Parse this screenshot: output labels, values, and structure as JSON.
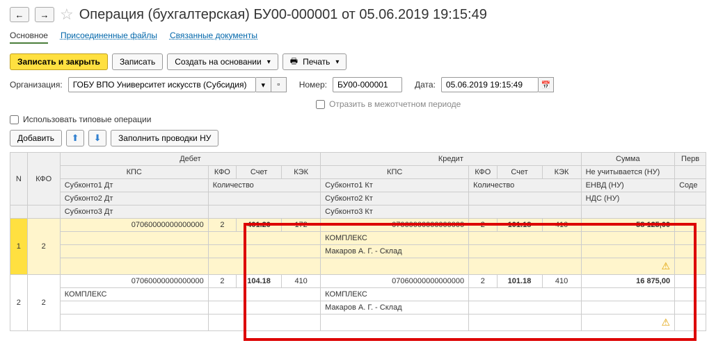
{
  "nav": {
    "back": "←",
    "forward": "→"
  },
  "title": "Операция (бухгалтерская) БУ00-000001 от 05.06.2019 19:15:49",
  "tabs": {
    "main": "Основное",
    "files": "Присоединенные файлы",
    "docs": "Связанные документы"
  },
  "toolbar1": {
    "save_close": "Записать и закрыть",
    "save": "Записать",
    "create_based": "Создать на основании",
    "print": "Печать"
  },
  "form": {
    "org_label": "Организация:",
    "org_value": "ГОБУ ВПО Университет искусств (Субсидия)",
    "number_label": "Номер:",
    "number_value": "БУ00-000001",
    "date_label": "Дата:",
    "date_value": "05.06.2019 19:15:49",
    "interperiod": "Отразить в межотчетном периоде",
    "use_typical": "Использовать типовые операции"
  },
  "toolbar2": {
    "add": "Добавить",
    "fill_nu": "Заполнить проводки НУ"
  },
  "grid": {
    "headers": {
      "n": "N",
      "kfo": "КФО",
      "debit": "Дебет",
      "credit": "Кредит",
      "sum": "Сумма",
      "perv": "Перв",
      "kps": "КПС",
      "kfo2": "КФО",
      "acct": "Счет",
      "kek": "КЭК",
      "not_nu": "Не учитывается (НУ)",
      "sub1d": "Субконто1 Дт",
      "sub2d": "Субконто2 Дт",
      "sub3d": "Субконто3 Дт",
      "qty": "Количество",
      "sub1k": "Субконто1 Кт",
      "sub2k": "Субконто2 Кт",
      "sub3k": "Субконто3 Кт",
      "envd": "ЕНВД (НУ)",
      "nds": "НДС (НУ)",
      "sod": "Соде"
    },
    "rows": [
      {
        "n": "1",
        "kfo": "2",
        "d_kps": "07060000000000000",
        "d_kfo": "2",
        "d_acct": "401.20",
        "d_kek": "172",
        "c_kps": "07060000000000000",
        "c_kfo": "2",
        "c_acct": "101.18",
        "c_kek": "410",
        "sum": "58 125,00",
        "c_sub1": "КОМПЛЕКС",
        "c_sub2": "Макаров А. Г. - Склад"
      },
      {
        "n": "2",
        "kfo": "2",
        "d_kps": "07060000000000000",
        "d_kfo": "2",
        "d_acct": "104.18",
        "d_kek": "410",
        "c_kps": "07060000000000000",
        "c_kfo": "2",
        "c_acct": "101.18",
        "c_kek": "410",
        "sum": "16 875,00",
        "d_sub1": "КОМПЛЕКС",
        "c_sub1": "КОМПЛЕКС",
        "c_sub2": "Макаров А. Г. - Склад"
      }
    ]
  }
}
